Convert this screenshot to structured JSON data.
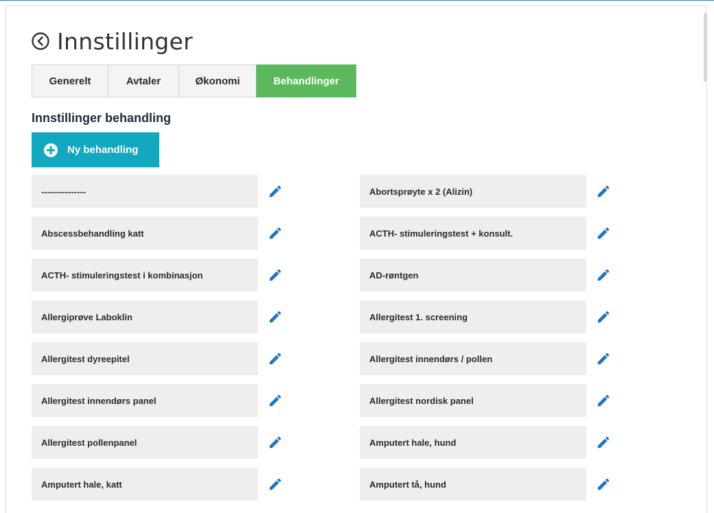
{
  "page": {
    "title": "Innstillinger",
    "back_icon": "chevron-left-circle-icon"
  },
  "tabs": [
    {
      "label": "Generelt",
      "active": false
    },
    {
      "label": "Avtaler",
      "active": false
    },
    {
      "label": "Økonomi",
      "active": false
    },
    {
      "label": "Behandlinger",
      "active": true
    }
  ],
  "section": {
    "title": "Innstillinger behandling",
    "new_button_label": "Ny behandling",
    "new_button_icon": "plus-circle-icon"
  },
  "colors": {
    "active_tab": "#5cb85c",
    "primary_button": "#11a8c0",
    "edit_icon": "#1f73c9",
    "item_background": "#eeeeee"
  },
  "treatments_left": [
    "---------------",
    "Abscessbehandling katt",
    "ACTH- stimuleringstest i kombinasjon",
    "Allergiprøve Laboklin",
    "Allergitest dyreepitel",
    "Allergitest innendørs panel",
    "Allergitest pollenpanel",
    "Amputert hale, katt"
  ],
  "treatments_right": [
    "Abortsprøyte x 2 (Alizin)",
    "ACTH- stimuleringstest + konsult.",
    "AD-røntgen",
    "Allergitest 1. screening",
    "Allergitest innendørs / pollen",
    "Allergitest nordisk panel",
    "Amputert hale, hund",
    "Amputert tå, hund"
  ]
}
